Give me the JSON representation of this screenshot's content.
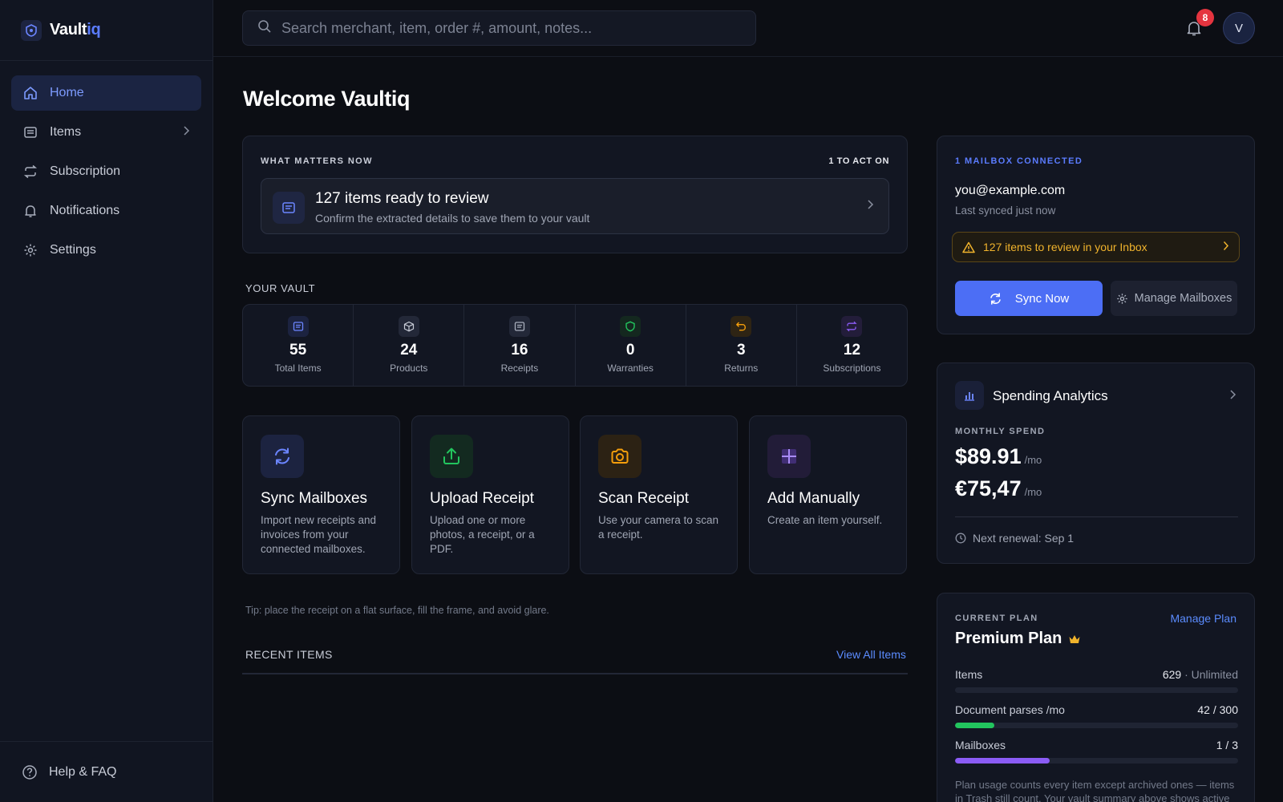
{
  "brand": {
    "name_main": "Vault",
    "name_accent": "iq"
  },
  "sidebar": {
    "items": [
      {
        "label": "Home",
        "icon": "home-icon",
        "active": true
      },
      {
        "label": "Items",
        "icon": "list-icon",
        "has_chevron": true
      },
      {
        "label": "Subscription",
        "icon": "repeat-icon"
      },
      {
        "label": "Notifications",
        "icon": "bell-icon"
      },
      {
        "label": "Settings",
        "icon": "gear-icon"
      }
    ],
    "help_label": "Help & FAQ"
  },
  "search": {
    "placeholder": "Search merchant, item, order #, amount, notes..."
  },
  "topbar": {
    "notification_count": "8",
    "avatar_initial": "V"
  },
  "page": {
    "title": "Welcome Vaultiq"
  },
  "what_matters": {
    "label": "WHAT MATTERS NOW",
    "count_label": "1 TO ACT ON",
    "review_title": "127 items ready to review",
    "review_subtitle": "Confirm the extracted details to save them to your vault"
  },
  "vault": {
    "label": "YOUR VAULT",
    "stats": [
      {
        "value": "55",
        "label": "Total Items",
        "color": "#6b85ff",
        "bg": "#1c2340"
      },
      {
        "value": "24",
        "label": "Products",
        "color": "#c7cbd6",
        "bg": "#232838"
      },
      {
        "value": "16",
        "label": "Receipts",
        "color": "#a9afbd",
        "bg": "#232838"
      },
      {
        "value": "0",
        "label": "Warranties",
        "color": "#22c55e",
        "bg": "#14281f"
      },
      {
        "value": "3",
        "label": "Returns",
        "color": "#f59e0b",
        "bg": "#2e2414"
      },
      {
        "value": "12",
        "label": "Subscriptions",
        "color": "#8b5cf6",
        "bg": "#231d3a"
      }
    ]
  },
  "actions": [
    {
      "title": "Sync Mailboxes",
      "desc": "Import new receipts and invoices from your connected mailboxes.",
      "color": "#6b85ff",
      "bg": "#1c2340"
    },
    {
      "title": "Upload Receipt",
      "desc": "Upload one or more photos, a receipt, or a PDF.",
      "color": "#22c55e",
      "bg": "#132a20"
    },
    {
      "title": "Scan Receipt",
      "desc": "Use your camera to scan a receipt.",
      "color": "#f59e0b",
      "bg": "#2c2214"
    },
    {
      "title": "Add Manually",
      "desc": "Create an item yourself.",
      "color": "#8b5cf6",
      "bg": "#221c38"
    }
  ],
  "tip": "Tip: place the receipt on a flat surface, fill the frame, and avoid glare.",
  "recent": {
    "label": "RECENT ITEMS",
    "view_all": "View All Items"
  },
  "mailbox": {
    "caption": "1 MAILBOX CONNECTED",
    "email": "you@example.com",
    "synced": "Last synced just now",
    "warning": "127 items to review in your Inbox",
    "sync_label": "Sync Now",
    "manage_label": "Manage Mailboxes"
  },
  "spending": {
    "title": "Spending Analytics",
    "caption": "MONTHLY SPEND",
    "amount_usd": "$89.91",
    "amount_eur": "€75,47",
    "per_unit": "/mo",
    "renewal": "Next renewal: Sep 1"
  },
  "plan": {
    "caption": "CURRENT PLAN",
    "manage_label": "Manage Plan",
    "name": "Premium Plan",
    "usage": [
      {
        "label": "Items",
        "value": "629",
        "limit": "Unlimited",
        "fraction": 0,
        "color": "#5b7cff"
      },
      {
        "label": "Document parses /mo",
        "value": "42 / 300",
        "fraction": 0.14,
        "color": "#22c55e"
      },
      {
        "label": "Mailboxes",
        "value": "1 / 3",
        "fraction": 0.333,
        "color": "#8b5cf6"
      }
    ],
    "note": "Plan usage counts every item except archived ones — items in Trash still count. Your vault summary above shows active"
  }
}
